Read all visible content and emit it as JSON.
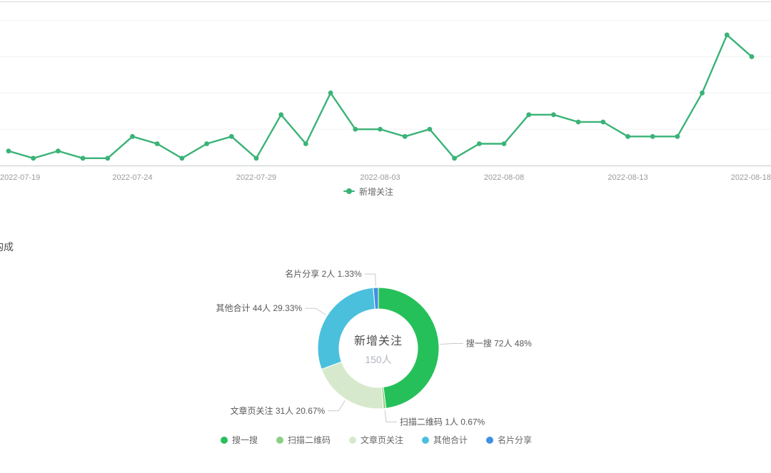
{
  "chart_data": [
    {
      "type": "line",
      "title": "",
      "x": [
        "2022-07-19",
        "2022-07-20",
        "2022-07-21",
        "2022-07-22",
        "2022-07-23",
        "2022-07-24",
        "2022-07-25",
        "2022-07-26",
        "2022-07-27",
        "2022-07-28",
        "2022-07-29",
        "2022-07-30",
        "2022-07-31",
        "2022-08-01",
        "2022-08-02",
        "2022-08-03",
        "2022-08-04",
        "2022-08-05",
        "2022-08-06",
        "2022-08-07",
        "2022-08-08",
        "2022-08-09",
        "2022-08-10",
        "2022-08-11",
        "2022-08-12",
        "2022-08-13",
        "2022-08-14",
        "2022-08-15",
        "2022-08-16",
        "2022-08-17",
        "2022-08-18"
      ],
      "x_tick_labels": [
        "2022-07-19",
        "2022-07-24",
        "2022-07-29",
        "2022-08-03",
        "2022-08-08",
        "2022-08-13",
        "2022-08-18"
      ],
      "series": [
        {
          "name": "新增关注",
          "values": [
            2,
            1,
            2,
            1,
            1,
            4,
            3,
            1,
            3,
            4,
            1,
            7,
            3,
            10,
            5,
            5,
            4,
            5,
            1,
            3,
            3,
            7,
            7,
            6,
            6,
            4,
            4,
            4,
            10,
            18,
            15
          ],
          "color": "#3ab377"
        }
      ],
      "ylim": [
        0,
        20
      ],
      "grid_values": [
        5,
        10,
        15,
        20
      ],
      "grid": "on",
      "legend_position": "bottom-center"
    },
    {
      "type": "pie",
      "subtype": "donut",
      "title": "构成",
      "center_label": "新增关注",
      "center_sublabel": "150人",
      "total": 150,
      "unit": "人",
      "segments": [
        {
          "name": "搜一搜",
          "value": 72,
          "pct": 48,
          "label": "搜一搜 72人 48%",
          "color": "#26c05a"
        },
        {
          "name": "扫描二维码",
          "value": 1,
          "pct": 0.67,
          "label": "扫描二维码 1人 0.67%",
          "color": "#8cd083"
        },
        {
          "name": "文章页关注",
          "value": 31,
          "pct": 20.67,
          "label": "文章页关注 31人 20.67%",
          "color": "#d7e9cc"
        },
        {
          "name": "其他合计",
          "value": 44,
          "pct": 29.33,
          "label": "其他合计 44人 29.33%",
          "color": "#4bc0dd"
        },
        {
          "name": "名片分享",
          "value": 2,
          "pct": 1.33,
          "label": "名片分享 2人 1.33%",
          "color": "#4090e3"
        }
      ],
      "legend_position": "bottom-center"
    }
  ]
}
